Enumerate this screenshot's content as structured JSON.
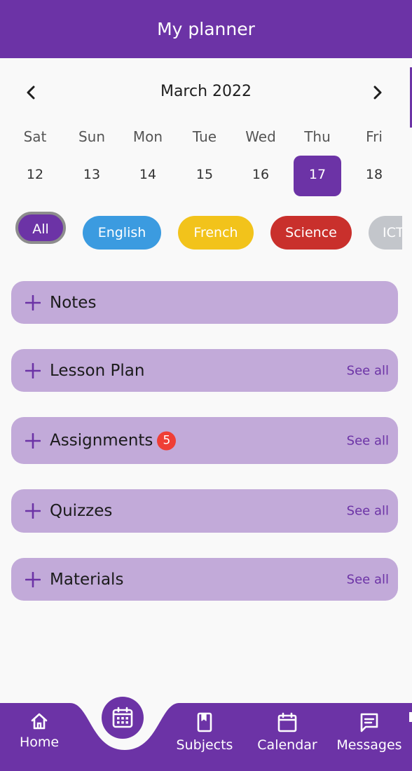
{
  "header": {
    "title": "My planner"
  },
  "calendar": {
    "month_label": "March 2022",
    "prev_icon": "chevron-left-icon",
    "next_icon": "chevron-right-icon",
    "days": [
      {
        "name": "Sat",
        "date": "12"
      },
      {
        "name": "Sun",
        "date": "13"
      },
      {
        "name": "Mon",
        "date": "14"
      },
      {
        "name": "Tue",
        "date": "15"
      },
      {
        "name": "Wed",
        "date": "16"
      },
      {
        "name": "Thu",
        "date": "17",
        "selected": true
      },
      {
        "name": "Fri",
        "date": "18"
      }
    ]
  },
  "filters": [
    {
      "label": "All",
      "color": "#6c33a6",
      "selected": true
    },
    {
      "label": "English",
      "color": "#3b9be0"
    },
    {
      "label": "French",
      "color": "#f2c31b"
    },
    {
      "label": "Science",
      "color": "#c9302c"
    },
    {
      "label": "ICT",
      "color": "#c3c6cb"
    }
  ],
  "sections": [
    {
      "title": "Notes",
      "icon": "plus-icon"
    },
    {
      "title": "Lesson Plan",
      "icon": "plus-icon",
      "see_all": "See all"
    },
    {
      "title": "Assignments",
      "icon": "plus-icon",
      "badge": "5",
      "see_all": "See all"
    },
    {
      "title": "Quizzes",
      "icon": "plus-icon",
      "see_all": "See all"
    },
    {
      "title": "Materials",
      "icon": "plus-icon",
      "see_all": "See all"
    }
  ],
  "bottom_nav": {
    "center_icon": "calendar-grid-icon",
    "tabs": [
      {
        "label": "Home",
        "icon": "home-icon"
      },
      {
        "label": "Subjects",
        "icon": "book-icon"
      },
      {
        "label": "Calendar",
        "icon": "calendar-icon"
      },
      {
        "label": "Messages",
        "icon": "message-icon"
      }
    ]
  },
  "colors": {
    "primary": "#6c33a6",
    "section_bg": "#c2aad9",
    "badge": "#ef3e36"
  }
}
